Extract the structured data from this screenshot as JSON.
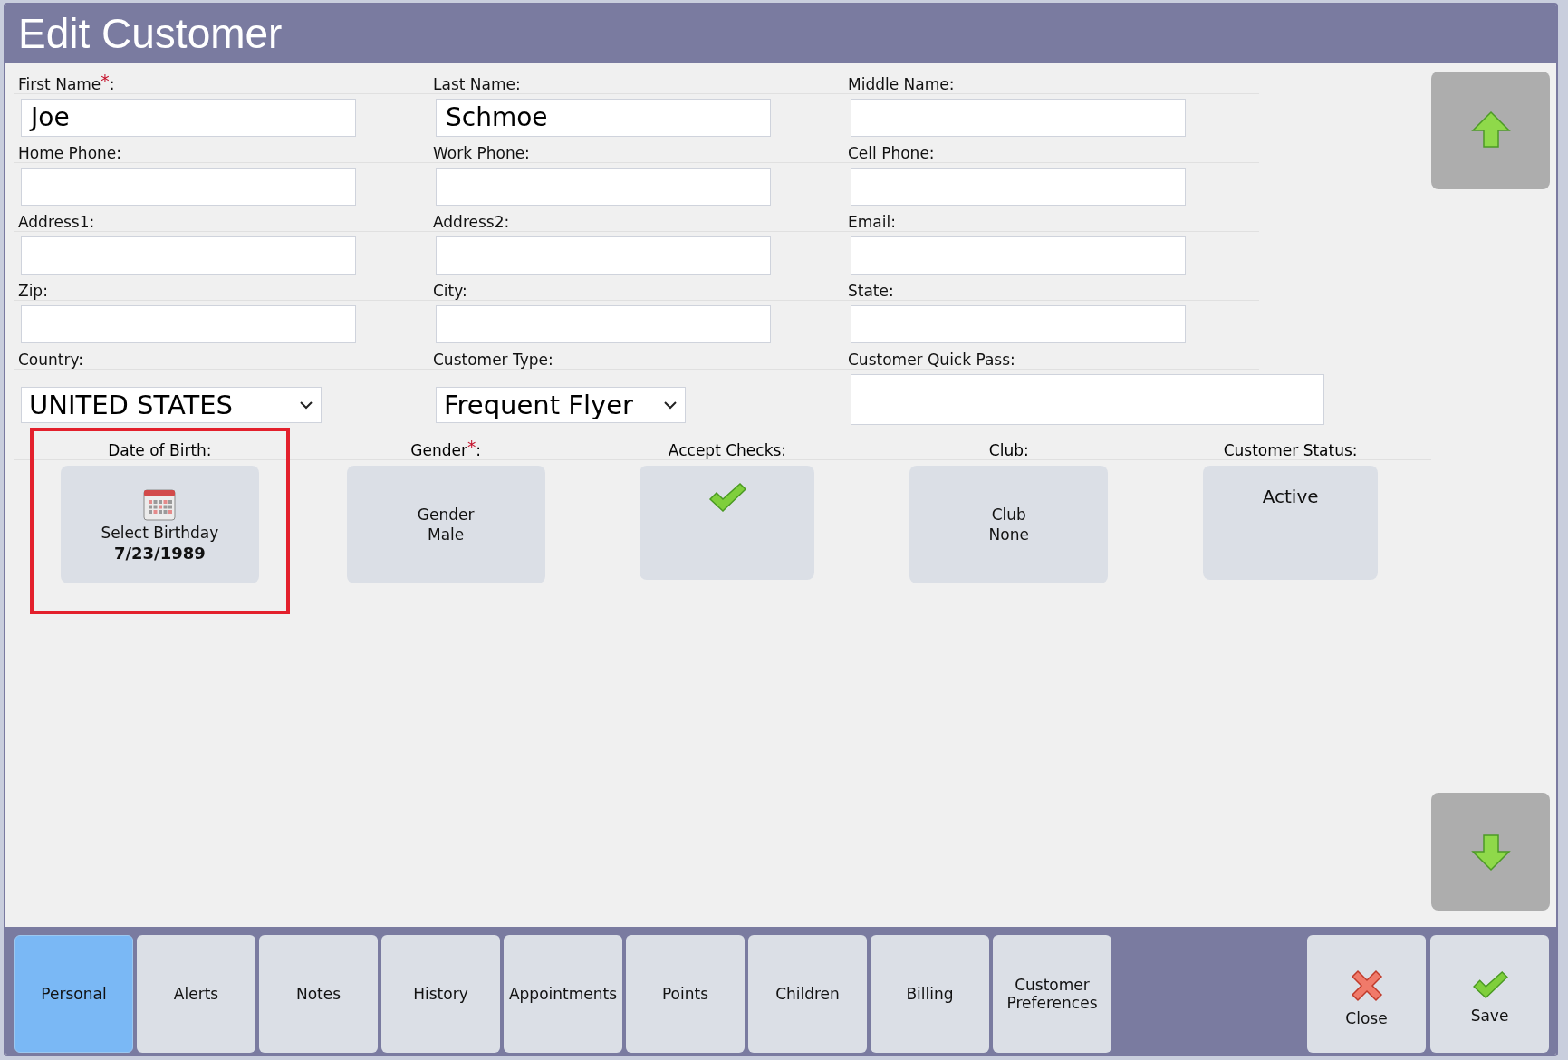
{
  "window": {
    "title": "Edit Customer"
  },
  "fields": [
    {
      "label": "First Name$^{*}$:",
      "kind": "text",
      "value": "Joe"
    },
    {
      "label": "Last Name:",
      "kind": "text",
      "value": "Schmoe"
    },
    {
      "label": "Middle Name:",
      "kind": "text"
    },
    {
      "label": "Home Phone:",
      "kind": "text"
    },
    {
      "label": "Work Phone:",
      "kind": "text"
    },
    {
      "label": "Cell Phone:",
      "kind": "text"
    },
    {
      "label": "Address1:",
      "kind": "text"
    },
    {
      "label": "Address2:",
      "kind": "text"
    },
    {
      "label": "Email:",
      "kind": "text"
    },
    {
      "label": "Zip:",
      "kind": "text"
    },
    {
      "label": "City:",
      "kind": "text"
    },
    {
      "label": "State:",
      "kind": "text"
    },
    {
      "label": "Country:",
      "kind": "select",
      "value": "UNITED STATES"
    },
    {
      "label": "Customer Type:",
      "kind": "select",
      "value": "Frequent Flyer"
    },
    {
      "label": "Customer Quick Pass:",
      "kind": "wide"
    }
  ],
  "tiles": [
    {
      "label": "Date of Birth:",
      "kind": "date",
      "text": "Select Birthday",
      "value": "7/23/1989",
      "highlighted": true
    },
    {
      "label": "Gender$^{*}$:",
      "kind": "lines",
      "lines": [
        "Gender",
        "Male"
      ],
      "highlighted": false
    },
    {
      "label": "Accept Checks:",
      "kind": "check",
      "checked": true,
      "highlighted": false
    },
    {
      "label": "Club:",
      "kind": "lines",
      "lines": [
        "Club",
        "None"
      ],
      "highlighted": false
    },
    {
      "label": "Customer Status:",
      "kind": "status",
      "text": "Active",
      "highlighted": false
    }
  ],
  "tabs": [
    {
      "label": "Personal",
      "selected": true
    },
    {
      "label": "Alerts",
      "selected": false
    },
    {
      "label": "Notes",
      "selected": false
    },
    {
      "label": "History",
      "selected": false
    },
    {
      "label": "Appointments",
      "selected": false
    },
    {
      "label": "Points",
      "selected": false
    },
    {
      "label": "Children",
      "selected": false
    },
    {
      "label": "Billing",
      "selected": false
    },
    {
      "label": "Customer Preferences",
      "selected": false
    }
  ],
  "actions": [
    {
      "kind": "close",
      "label": "Close"
    },
    {
      "kind": "save",
      "label": "Save"
    }
  ]
}
